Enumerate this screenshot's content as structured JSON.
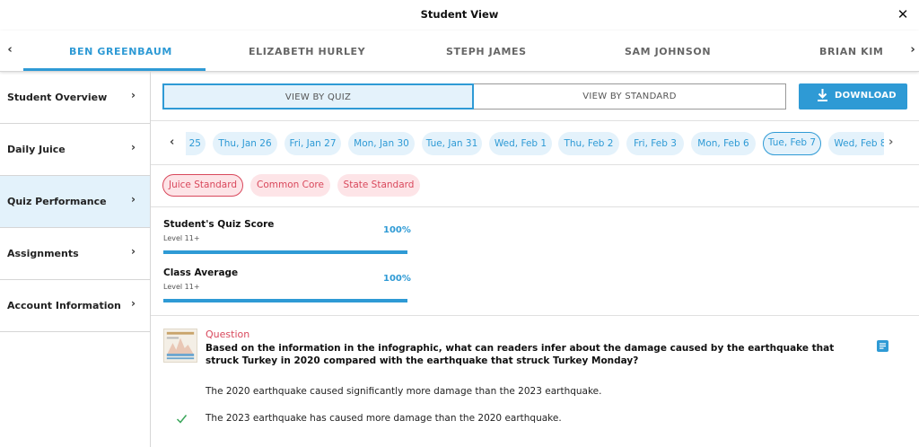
{
  "window": {
    "title": "Student View",
    "close_icon": "close-icon"
  },
  "students": {
    "prev_icon": "chevron-left-icon",
    "next_icon": "chevron-right-icon",
    "tabs": [
      {
        "label": "BEN GREENBAUM",
        "active": true
      },
      {
        "label": "ELIZABETH HURLEY",
        "active": false
      },
      {
        "label": "STEPH JAMES",
        "active": false
      },
      {
        "label": "SAM JOHNSON",
        "active": false
      },
      {
        "label": "BRIAN KIM",
        "active": false
      }
    ]
  },
  "sidebar": {
    "items": [
      {
        "label": "Student Overview",
        "active": false
      },
      {
        "label": "Daily Juice",
        "active": false
      },
      {
        "label": "Quiz Performance",
        "active": true
      },
      {
        "label": "Assignments",
        "active": false
      },
      {
        "label": "Account Information",
        "active": false
      }
    ]
  },
  "view_toggle": {
    "by_quiz": "VIEW BY QUIZ",
    "by_standard": "VIEW BY STANDARD",
    "selected": "by_quiz"
  },
  "download": {
    "label": "DOWNLOAD",
    "icon": "download-icon"
  },
  "dates": {
    "items": [
      "25",
      "Thu, Jan 26",
      "Fri, Jan 27",
      "Mon, Jan 30",
      "Tue, Jan 31",
      "Wed, Feb 1",
      "Thu, Feb 2",
      "Fri, Feb 3",
      "Mon, Feb 6",
      "Tue, Feb 7",
      "Wed, Feb 8"
    ],
    "selected": "Tue, Feb 7"
  },
  "standards": {
    "items": [
      "Juice Standard",
      "Common Core",
      "State Standard"
    ],
    "selected": "Juice Standard"
  },
  "scores": [
    {
      "name": "Student's Quiz Score",
      "level": "Level 11+",
      "percent_text": "100%",
      "fraction": 1.0
    },
    {
      "name": "Class Average",
      "level": "Level 11+",
      "percent_text": "100%",
      "fraction": 1.0
    }
  ],
  "question": {
    "label": "Question",
    "text": "Based on the information in the infographic, what can readers infer about the damage caused by the earthquake that struck Turkey in 2020 compared with the earthquake that struck Turkey Monday?",
    "answers": [
      {
        "text": "The 2020 earthquake caused significantly more damage than the 2023 earthquake.",
        "correct": false
      },
      {
        "text": "The 2023 earthquake has caused more damage than the 2020 earthquake.",
        "correct": true
      }
    ]
  },
  "colors": {
    "accent": "#2e9ad5",
    "standard_pill": "#d9485c",
    "correct": "#3aa65a"
  }
}
